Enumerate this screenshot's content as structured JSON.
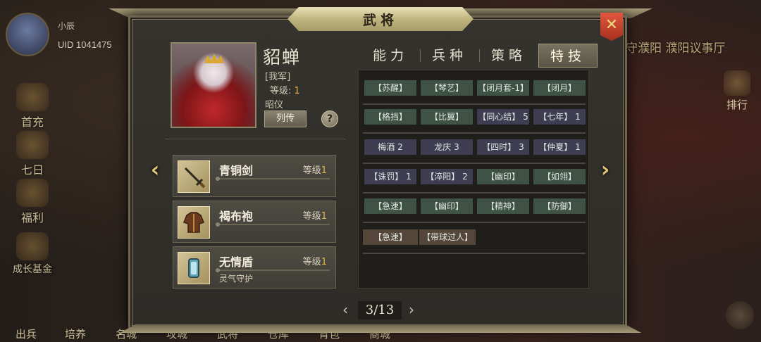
{
  "background": {
    "player_id": "小辰",
    "uid": "UID  1041475",
    "side_menu": [
      "首充",
      "七日",
      "福利",
      "成长基金"
    ],
    "right_text": "守濮阳 濮阳议事厅",
    "rank_label": "排行",
    "bottom_menu": [
      "出兵",
      "培养",
      "名城",
      "攻城",
      "武将",
      "仓库",
      "背包",
      "商城"
    ]
  },
  "modal": {
    "title": "武将",
    "close_icon": "close-icon"
  },
  "hero": {
    "name": "貂蝉",
    "side": "[我军]",
    "level_label": "等级:",
    "level_value": "1",
    "title": "昭仪",
    "bio_button": "列传",
    "help_button": "?"
  },
  "equipment": [
    {
      "name": "青铜剑",
      "level_label": "等级",
      "level": "1",
      "sub": "",
      "icon": "sword-icon"
    },
    {
      "name": "褐布袍",
      "level_label": "等级",
      "level": "1",
      "sub": "",
      "icon": "robe-icon"
    },
    {
      "name": "无情盾",
      "level_label": "等级",
      "level": "1",
      "sub": "灵气守护",
      "icon": "shield-icon"
    }
  ],
  "tabs": [
    "能力",
    "兵种",
    "策略",
    "特技"
  ],
  "active_tab": "特技",
  "skills": [
    [
      {
        "label": "【苏醒】",
        "color": "green"
      },
      {
        "label": "【琴艺】",
        "color": "green"
      },
      {
        "label": "【闭月套-1】",
        "color": "green"
      },
      {
        "label": "【闭月】",
        "color": "green"
      }
    ],
    [
      {
        "label": "【格挡】",
        "color": "green"
      },
      {
        "label": "【比翼】",
        "color": "green"
      },
      {
        "label": "【同心结】 5",
        "color": "purple"
      },
      {
        "label": "【七年】 1",
        "color": "purple"
      }
    ],
    [
      {
        "label": "梅酒 2",
        "color": "purple"
      },
      {
        "label": "龙庆 3",
        "color": "purple"
      },
      {
        "label": "【四时】 3",
        "color": "purple"
      },
      {
        "label": "【仲夏】 1",
        "color": "purple"
      }
    ],
    [
      {
        "label": "【诛罚】 1",
        "color": "purple"
      },
      {
        "label": "【淬阳】 2",
        "color": "purple"
      },
      {
        "label": "【幽印】",
        "color": "green"
      },
      {
        "label": "【如翎】",
        "color": "green"
      }
    ],
    [
      {
        "label": "【急速】",
        "color": "green"
      },
      {
        "label": "【幽印】",
        "color": "green"
      },
      {
        "label": "【精神】",
        "color": "green"
      },
      {
        "label": "【防御】",
        "color": "green"
      }
    ],
    [
      {
        "label": "【急速】",
        "color": "brown"
      },
      {
        "label": "【带球过人】",
        "color": "brown"
      }
    ]
  ],
  "pagination": {
    "current": "3/13",
    "prev_icon": "chevron-left-icon",
    "next_icon": "chevron-right-icon"
  },
  "colors": {
    "accent_gold": "#e9b54a",
    "close_red": "#c8402a",
    "tag_green": "#3f5246",
    "tag_purple": "#3f3d52",
    "tag_brown": "#54473a"
  }
}
